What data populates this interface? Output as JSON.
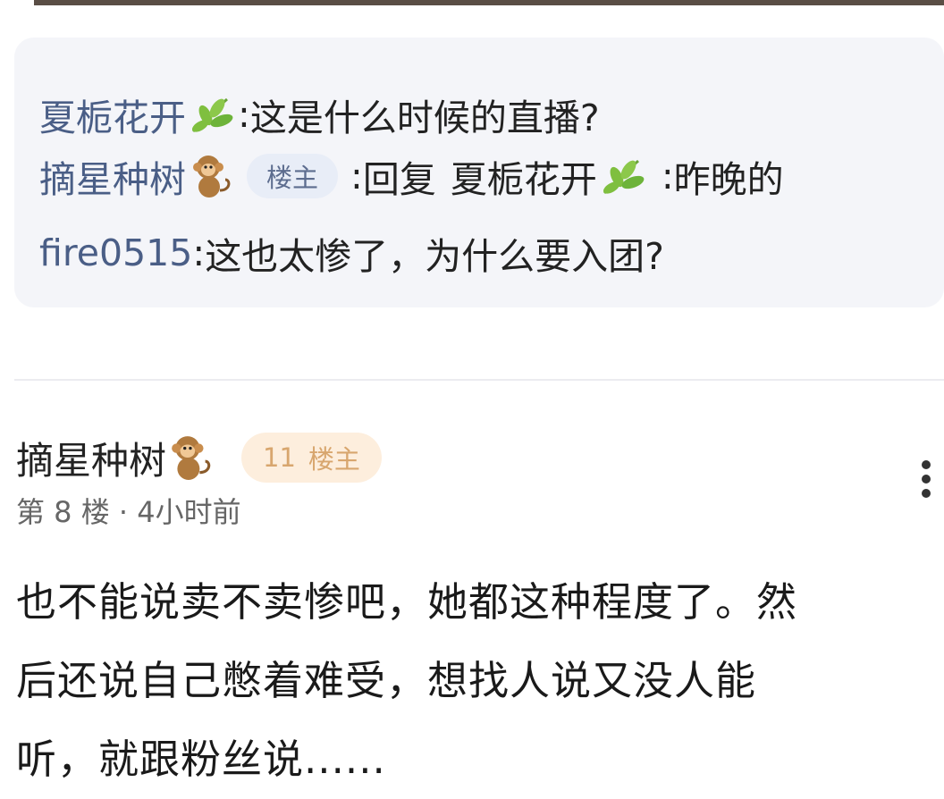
{
  "reply_preview": {
    "lines": [
      {
        "user": "夏栀花开",
        "sep": ":",
        "text": "这是什么时候的直播?"
      },
      {
        "user": "摘星种树",
        "badge": "楼主",
        "sep": ":",
        "reply_prefix": "回复",
        "reply_to": "夏栀花开",
        "text": "昨晚的"
      },
      {
        "user": "fire0515",
        "sep": ":",
        "text": "这也太惨了，为什么要入团?"
      }
    ]
  },
  "post": {
    "author": "摘星种树",
    "level": "11",
    "owner_badge": "楼主",
    "floor": "第 8 楼",
    "dot": "·",
    "time": "4小时前",
    "content_lines": [
      "也不能说卖不卖惨吧，她都这种程度了。然",
      "后还说自己憋着难受，想找人说又没人能",
      "听，就跟粉丝说......"
    ]
  },
  "icons": {
    "leaf": "leaf-emoji-icon",
    "monkey": "monkey-avatar-icon",
    "more": "more-vertical-icon"
  },
  "colors": {
    "username": "#4a5e86",
    "reply_bg": "#f4f5f9",
    "owner_badge_bg": "#e8edf7",
    "level_badge_bg": "#fdeedd",
    "level_badge_text": "#d8a66e"
  }
}
